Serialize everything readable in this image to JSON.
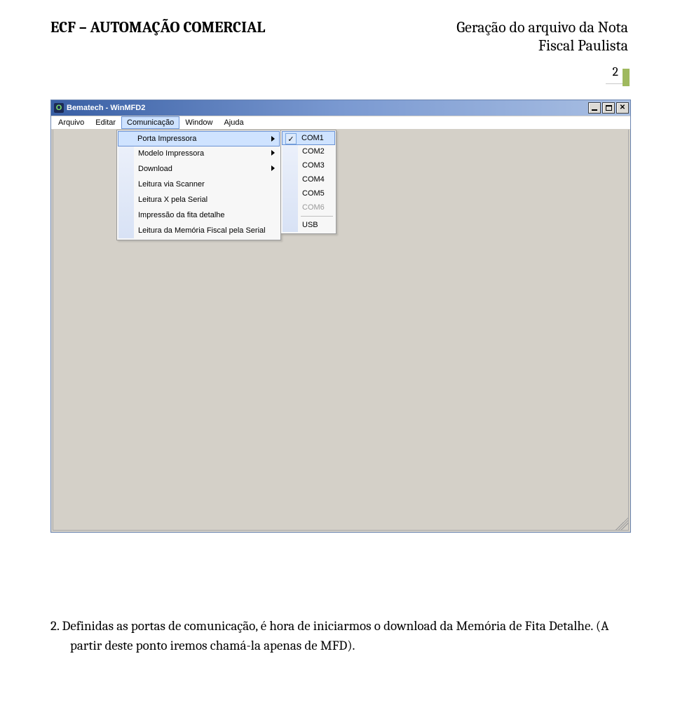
{
  "header": {
    "left": "ECF – AUTOMAÇÃO COMERCIAL",
    "right_line1": "Geração do arquivo da Nota",
    "right_line2": "Fiscal Paulista"
  },
  "page_number": "2",
  "window": {
    "title": "Bematech - WinMFD2",
    "icon_glyph": "O"
  },
  "menubar": [
    "Arquivo",
    "Editar",
    "Comunicação",
    "Window",
    "Ajuda"
  ],
  "menubar_active_index": 2,
  "dropdown": {
    "items": [
      {
        "label": "Porta Impressora",
        "has_submenu": true,
        "hover": true
      },
      {
        "label": "Modelo Impressora",
        "has_submenu": true
      },
      {
        "label": "Download",
        "has_submenu": true
      },
      {
        "label": "Leitura via Scanner"
      },
      {
        "label": "Leitura X pela Serial"
      },
      {
        "label": "Impressão da fita detalhe"
      },
      {
        "label": "Leitura da Memória Fiscal pela Serial"
      }
    ]
  },
  "submenu": {
    "items": [
      {
        "label": "COM1",
        "checked": true,
        "hover": true
      },
      {
        "label": "COM2"
      },
      {
        "label": "COM3"
      },
      {
        "label": "COM4"
      },
      {
        "label": "COM5"
      },
      {
        "label": "COM6",
        "disabled": true
      },
      {
        "separator": true
      },
      {
        "label": "USB"
      }
    ]
  },
  "body_paragraph": "2.  Definidas as portas de comunicação, é hora de iniciarmos o download da Memória de Fita Detalhe. (A partir deste ponto iremos chamá-la apenas de MFD)."
}
